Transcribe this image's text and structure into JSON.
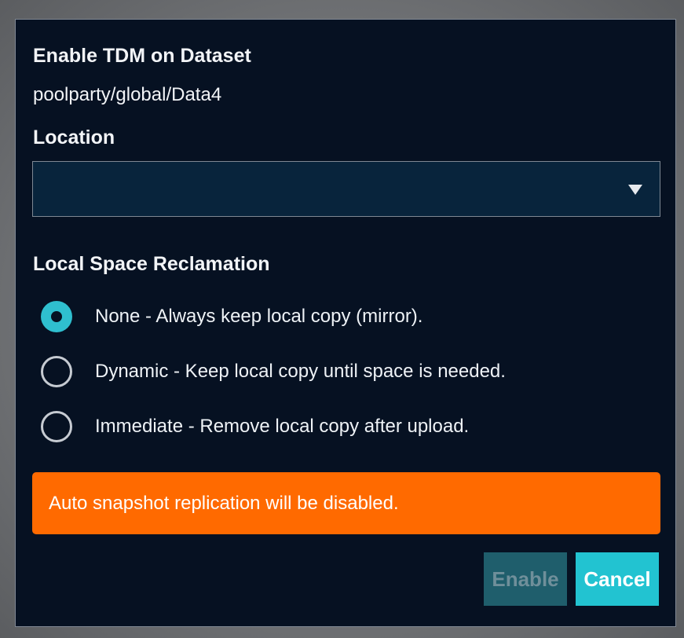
{
  "dialog": {
    "title": "Enable TDM on Dataset",
    "dataset_path": "poolparty/global/Data4"
  },
  "location": {
    "label": "Location",
    "selected_value": "",
    "icon": "chevron-down-icon"
  },
  "reclamation": {
    "label": "Local Space Reclamation",
    "options": [
      {
        "label": "None - Always keep local copy (mirror).",
        "selected": true
      },
      {
        "label": "Dynamic - Keep local copy until space is needed.",
        "selected": false
      },
      {
        "label": "Immediate - Remove local copy after upload.",
        "selected": false
      }
    ]
  },
  "alert": {
    "message": "Auto snapshot replication will be disabled.",
    "color": "#ff6a00"
  },
  "buttons": {
    "enable_label": "Enable",
    "cancel_label": "Cancel",
    "enable_disabled": true
  },
  "colors": {
    "dialog_background": "#061122",
    "accent": "#22c3d1",
    "disabled_button": "#1f5e6c"
  }
}
